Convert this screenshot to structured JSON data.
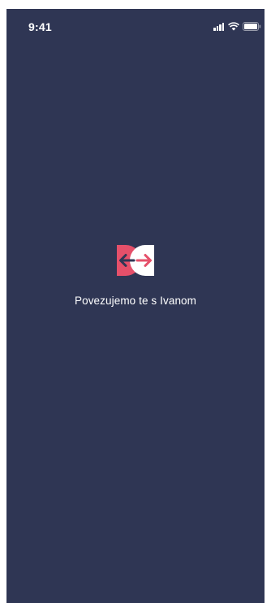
{
  "status_bar": {
    "time": "9:41",
    "icons": [
      "signal-icon",
      "wifi-icon",
      "battery-icon"
    ]
  },
  "screen": {
    "background_color": "#2f3654",
    "logo": {
      "icon": "app-logo-icon",
      "colors": {
        "left": "#e5506a",
        "right": "#ffffff",
        "arrows": "#2f3654"
      }
    },
    "message": "Povezujemo te s Ivanom"
  }
}
